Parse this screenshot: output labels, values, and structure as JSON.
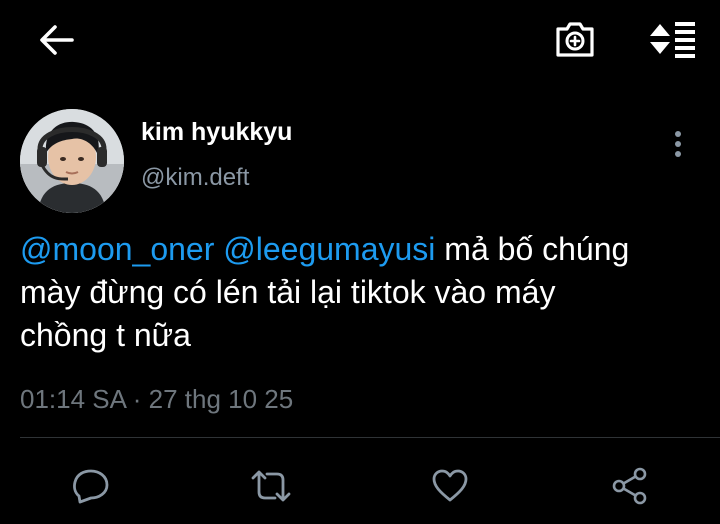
{
  "topbar": {
    "back_icon": "arrow-left-icon",
    "camera_icon": "camera-plus-icon",
    "sort_icon": "sort-lines-icon"
  },
  "tweet": {
    "author_name": "kim hyukkyu",
    "author_handle": "@kim.deft",
    "mention_1": "@moon_oner",
    "mention_2": "@leegumayusi",
    "body_line_1": "mả bố chúng",
    "body_line_2": "mày đừng có lén tải lại tiktok vào máy",
    "body_line_3": "chồng t nữa",
    "timestamp": "01:14 SA · 27 thg 10 25"
  },
  "actions": {
    "reply_icon": "comment-icon",
    "retweet_icon": "retweet-icon",
    "like_icon": "heart-icon",
    "share_icon": "share-icon"
  },
  "colors": {
    "background": "#000000",
    "link": "#1d9bf0",
    "secondary_text": "#8b98a5",
    "timestamp": "#6e767d",
    "divider": "#2f3336"
  }
}
